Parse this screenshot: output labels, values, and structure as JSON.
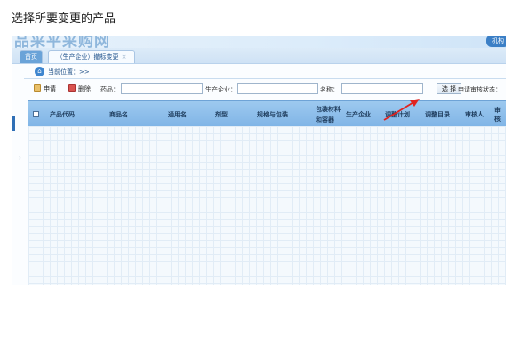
{
  "caption": "选择所要变更的产品",
  "banner": {
    "logo_text": "品采平采购网",
    "right_label": "机构"
  },
  "tabs": [
    {
      "label": "首页"
    },
    {
      "label": "（生产企业）撤标变更"
    }
  ],
  "tab_close": "×",
  "breadcrumb": {
    "icon": "home-icon",
    "text": "当前位置：>>"
  },
  "toolbar": {
    "apply_label": "申请",
    "delete_label": "删除",
    "drug_label": "药品：",
    "drug_value": "",
    "company_label": "生产企业：",
    "company_value": "",
    "name_label": "名称：",
    "name_value": "",
    "search_label": "选 择",
    "status_label": "申请审核状态："
  },
  "table": {
    "columns": [
      "产品代码",
      "商品名",
      "通用名",
      "剂型",
      "规格与包装",
      "包装材料",
      "和容器",
      "生产企业",
      "调整计划",
      "调整目录",
      "审核人",
      "审核"
    ],
    "rows": []
  },
  "colors": {
    "header_bg": "#8fbfeb",
    "arrow": "#e0231f",
    "accent": "#3f86cf"
  }
}
